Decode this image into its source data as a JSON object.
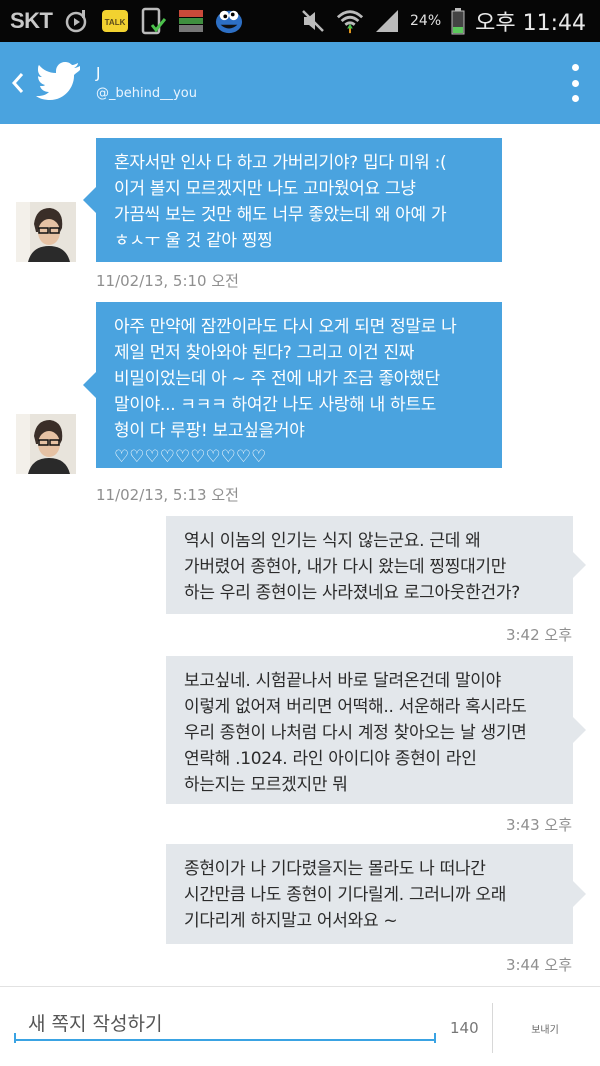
{
  "status_bar": {
    "carrier": "SKT",
    "icons": [
      "media-icon",
      "kakaotalk-icon",
      "download-complete-icon",
      "app-icon",
      "cookie-monster-icon"
    ],
    "battery_percent": "24%",
    "time": "오후 11:44"
  },
  "header": {
    "name": "J",
    "handle": "@_behind__you"
  },
  "messages": [
    {
      "direction": "incoming",
      "lines": [
        "혼자서만 인사 다 하고 가버리기야? 밉다 미워 :(",
        "이거 볼지 모르겠지만 나도 고마웠어요 그냥",
        "가끔씩 보는 것만 해도 너무 좋았는데 왜 아예 가",
        "ㅎㅅㅜ 울 것 같아 찡찡"
      ],
      "timestamp": "11/02/13, 5:10 오전"
    },
    {
      "direction": "incoming",
      "lines": [
        "아주 만약에 잠깐이라도 다시 오게 되면 정말로 나",
        "제일 먼저 찾아와야 된다? 그리고 이건 진짜",
        "비밀이었는데 아 ~ 주 전에 내가 조금 좋아했단",
        "말이야... ㅋㅋㅋ 하여간 나도 사랑해 내 하트도",
        "형이 다 루팡! 보고싶을거야",
        "♡♡♡♡♡♡♡♡♡♡"
      ],
      "timestamp": "11/02/13, 5:13 오전"
    },
    {
      "direction": "outgoing",
      "lines": [
        "역시 이놈의 인기는 식지 않는군요. 근데 왜",
        "가버렸어 종현아, 내가 다시 왔는데 찡찡대기만",
        "하는 우리 종현이는 사라졌네요  로그아웃한건가?"
      ],
      "timestamp": "3:42 오후"
    },
    {
      "direction": "outgoing",
      "lines": [
        "보고싶네. 시험끝나서 바로 달려온건데 말이야",
        "이렇게 없어져 버리면 어떡해.. 서운해라 혹시라도",
        "우리 종현이 나처럼 다시 계정 찾아오는 날 생기면",
        "연락해 .1024. 라인 아이디야 종현이 라인",
        "하는지는 모르겠지만 뭐"
      ],
      "timestamp": "3:43 오후"
    },
    {
      "direction": "outgoing",
      "lines": [
        "종현이가 나 기다렸을지는 몰라도 나 떠나간",
        "시간만큼 나도 종현이 기다릴게. 그러니까 오래",
        "기다리게 하지말고 어서와요 ~"
      ],
      "timestamp": "3:44 오후"
    }
  ],
  "composer": {
    "placeholder": "새 쪽지 작성하기",
    "char_count": "140",
    "send_label": "보내기"
  },
  "colors": {
    "accent": "#4aa3df",
    "incoming_bubble": "#4aa3df",
    "outgoing_bubble": "#e3e7eb",
    "status_bar": "#060606"
  }
}
